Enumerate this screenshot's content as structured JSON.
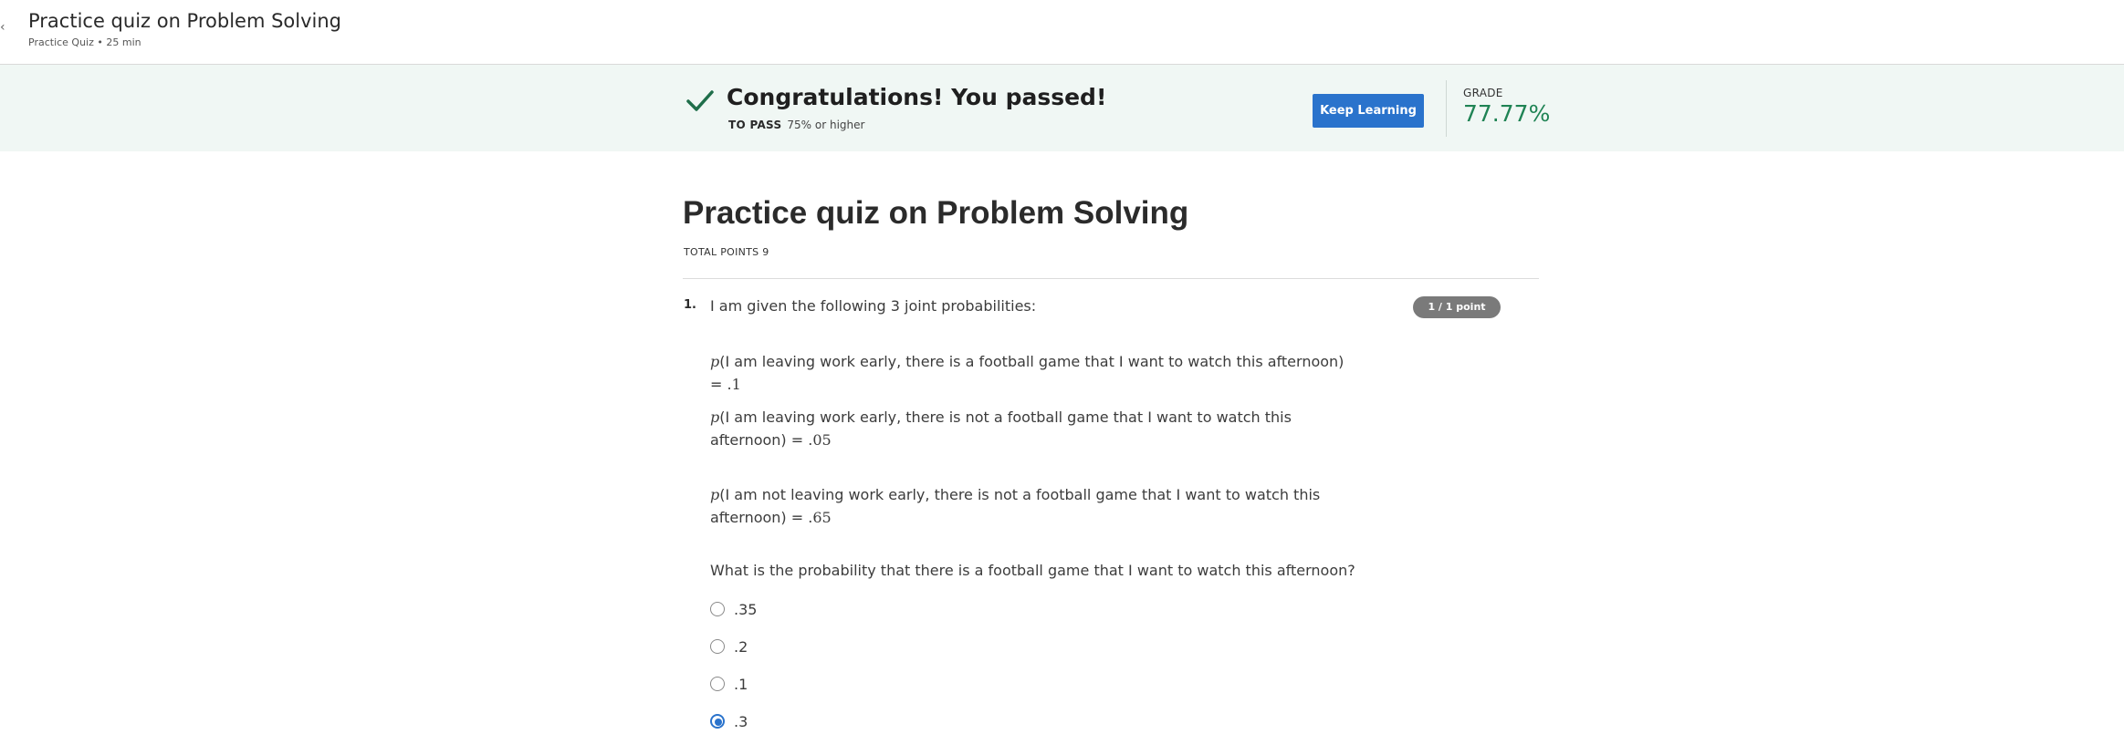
{
  "header": {
    "title": "Practice quiz on Problem Solving",
    "subtitle": "Practice Quiz • 25 min"
  },
  "banner": {
    "message": "Congratulations! You passed!",
    "to_pass_label": "TO PASS",
    "to_pass_value": "75% or higher",
    "keep_learning_label": "Keep Learning",
    "grade_label": "GRADE",
    "grade_value": "77.77%",
    "icon": "check-icon",
    "colors": {
      "success": "#1f8354",
      "primary": "#2a73cc",
      "banner_bg": "#f0f7f4"
    }
  },
  "quiz": {
    "title": "Practice quiz on Problem Solving",
    "total_points": "TOTAL POINTS 9",
    "question": {
      "number": "1.",
      "intro": "I am given the following 3 joint probabilities:",
      "points_badge": "1 / 1 point",
      "probabilities": [
        {
          "p": "p",
          "text": "(I am leaving work early, there is a football game that I want to watch this afternoon) = ",
          "value": ".1"
        },
        {
          "p": "p",
          "text": "(I am leaving work early, there is not a football game that I want to watch this afternoon) = ",
          "value": ".05"
        },
        {
          "p": "p",
          "text": "(I am not leaving work early, there is not a football game that I want to watch this afternoon) = ",
          "value": ".65"
        }
      ],
      "prompt": "What is the probability that there is a football game that I want to watch this afternoon?",
      "options": [
        {
          "label": ".35",
          "selected": false
        },
        {
          "label": ".2",
          "selected": false
        },
        {
          "label": ".1",
          "selected": false
        },
        {
          "label": ".3",
          "selected": true
        }
      ]
    }
  }
}
